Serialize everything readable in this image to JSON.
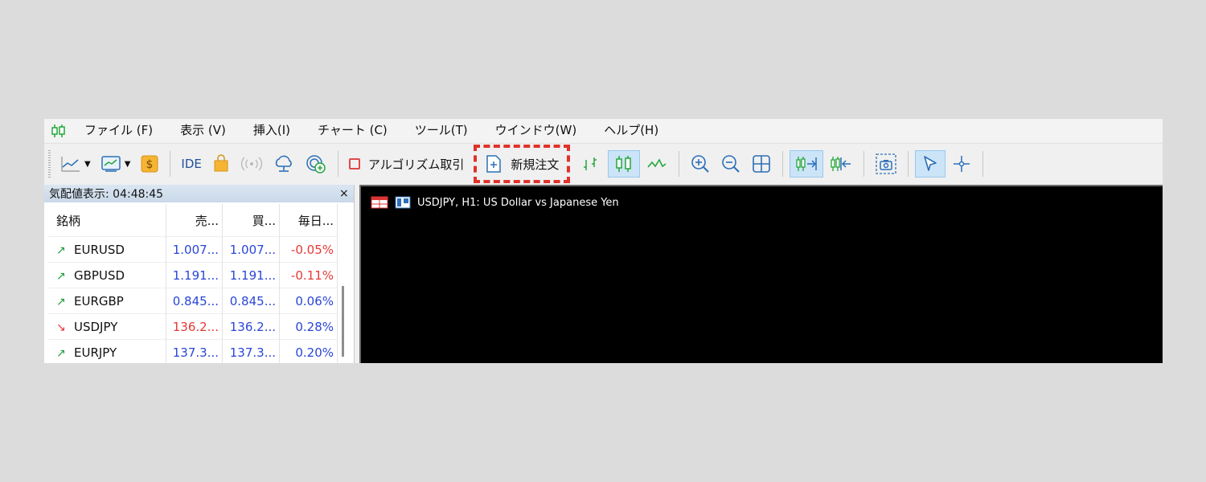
{
  "menu": {
    "file": "ファイル (F)",
    "view": "表示 (V)",
    "insert": "挿入(I)",
    "chart": "チャート (C)",
    "tools": "ツール(T)",
    "window": "ウインドウ(W)",
    "help": "ヘルプ(H)"
  },
  "toolbar": {
    "ide": "IDE",
    "algo_trading": "アルゴリズム取引",
    "new_order": "新規注文"
  },
  "market_watch": {
    "title": "気配値表示: 04:48:45",
    "close": "×",
    "columns": {
      "symbol": "銘柄",
      "bid": "売...",
      "ask": "買...",
      "daily_change": "毎日..."
    },
    "rows": [
      {
        "arrow": "↗",
        "symbol": "EURUSD",
        "bid": "1.007...",
        "ask": "1.007...",
        "change": "-0.05%"
      },
      {
        "arrow": "↗",
        "symbol": "GBPUSD",
        "bid": "1.191...",
        "ask": "1.191...",
        "change": "-0.11%"
      },
      {
        "arrow": "↗",
        "symbol": "EURGBP",
        "bid": "0.845...",
        "ask": "0.845...",
        "change": "0.06%"
      },
      {
        "arrow": "↘",
        "symbol": "USDJPY",
        "bid": "136.2...",
        "ask": "136.2...",
        "change": "0.28%"
      },
      {
        "arrow": "↗",
        "symbol": "EURJPY",
        "bid": "137.3...",
        "ask": "137.3...",
        "change": "0.20%"
      }
    ]
  },
  "chart_window": {
    "title": "USDJPY, H1:  US Dollar vs Japanese Yen"
  },
  "colors": {
    "up": "#1f9b3a",
    "down": "#e53935",
    "price_blue": "#2a45d8",
    "negative_change": "#e53935",
    "highlight": "#e0322a"
  }
}
